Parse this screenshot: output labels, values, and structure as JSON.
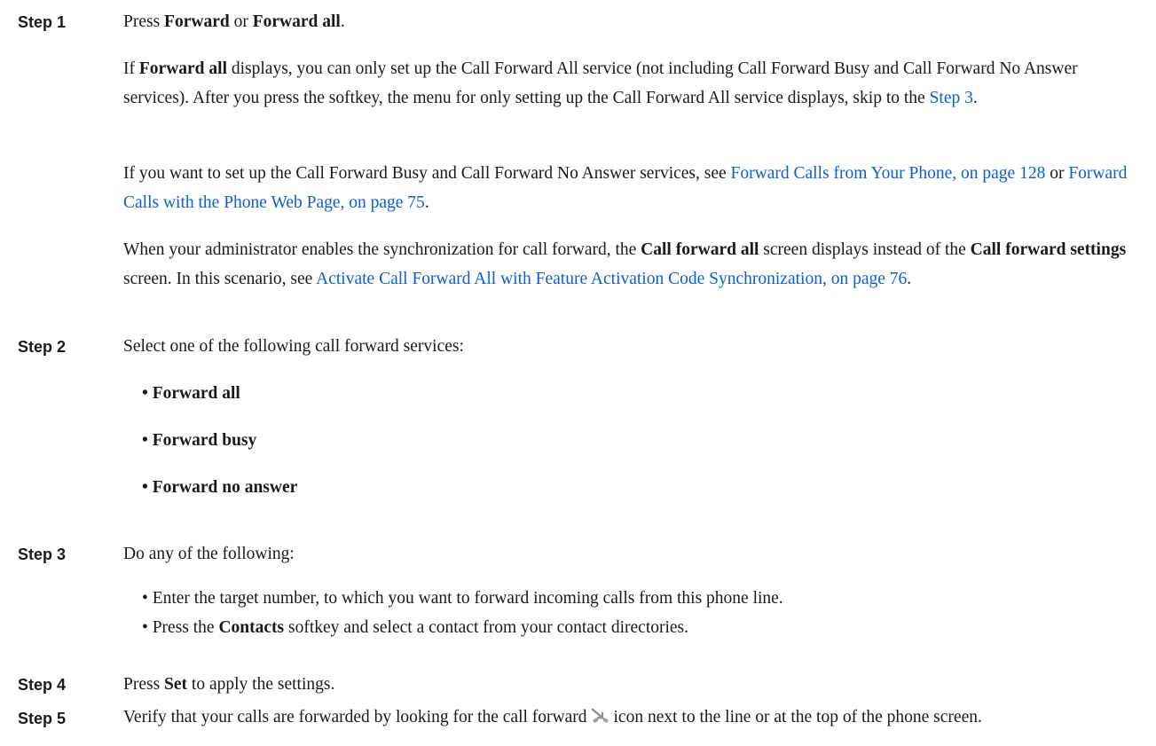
{
  "steps": [
    {
      "label": "Step 1",
      "intro": [
        "Press ",
        "Forward",
        " or ",
        "Forward all",
        "."
      ],
      "para1": [
        "If ",
        "Forward all",
        " displays, you can only set up the Call Forward All service (not including Call Forward Busy and Call Forward No Answer services). After you press the softkey, the menu for only setting up the Call Forward All service displays, skip to the ",
        "Step 3",
        "."
      ],
      "para2": [
        "If you want to set up the Call Forward Busy and Call Forward No Answer services, see ",
        "Forward Calls from Your Phone, on page 128",
        " or ",
        "Forward Calls with the Phone Web Page, on page 75",
        "."
      ],
      "para3": [
        "When your administrator enables the synchronization for call forward, the ",
        "Call forward all",
        " screen displays instead of the ",
        "Call forward settings",
        " screen. In this scenario, see ",
        "Activate Call Forward All with Feature Activation Code Synchronization, on page 76",
        "."
      ]
    },
    {
      "label": "Step 2",
      "intro": "Select one of the following call forward services:",
      "bullets": [
        "Forward all",
        "Forward busy",
        "Forward no answer"
      ]
    },
    {
      "label": "Step 3",
      "intro": "Do any of the following:",
      "bullet1": "Enter the target number, to which you want to forward incoming calls from this phone line.",
      "bullet2": [
        "Press the ",
        "Contacts",
        " softkey and select a contact from your contact directories."
      ]
    },
    {
      "label": "Step 4",
      "intro": [
        "Press ",
        "Set",
        " to apply the settings."
      ]
    },
    {
      "label": "Step 5",
      "text_before_icon": "Verify that your calls are forwarded by looking for the call forward",
      "icon": "call-forward-icon",
      "text_after_icon": "icon next to the line or at the top of the phone screen."
    }
  ],
  "bullet_char": "•",
  "link_color": "#0a5fd8"
}
